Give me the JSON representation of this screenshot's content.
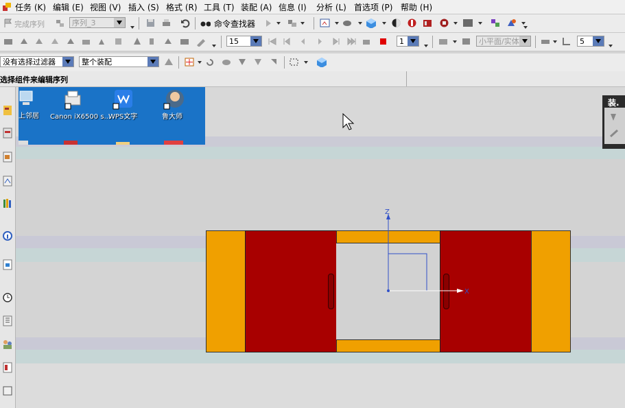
{
  "menubar": {
    "items": [
      "任务 (K)",
      "编辑 (E)",
      "视图 (V)",
      "插入 (S)",
      "格式 (R)",
      "工具 (T)",
      "装配 (A)",
      "信息 (I)",
      "分析 (L)",
      "首选项 (P)",
      "帮助 (H)"
    ]
  },
  "toolbar1": {
    "finish_sequence": "完成序列",
    "sequence_select": "序列_3",
    "command_finder": "命令查找器"
  },
  "toolbar2": {
    "frame_value": "15",
    "step_value": "1",
    "plane_select": "小平面/实体",
    "count_value": "5"
  },
  "toolbar3": {
    "filter_select": "没有选择过滤器",
    "scope_select": "整个装配"
  },
  "status": {
    "prompt": "选择组件来编辑序列"
  },
  "desktop": {
    "icons": [
      {
        "label": "上邻居"
      },
      {
        "label": "Canon iX6500 s..."
      },
      {
        "label": "WPS文字"
      },
      {
        "label": "鲁大师"
      }
    ]
  },
  "right_panel": {
    "title": "装."
  },
  "axes": {
    "z_label": "Z",
    "x_label": "X"
  },
  "colors": {
    "orange": "#f0a000",
    "red": "#a80000",
    "desktop_blue": "#1a73c7",
    "axis_blue": "#3050c8"
  }
}
